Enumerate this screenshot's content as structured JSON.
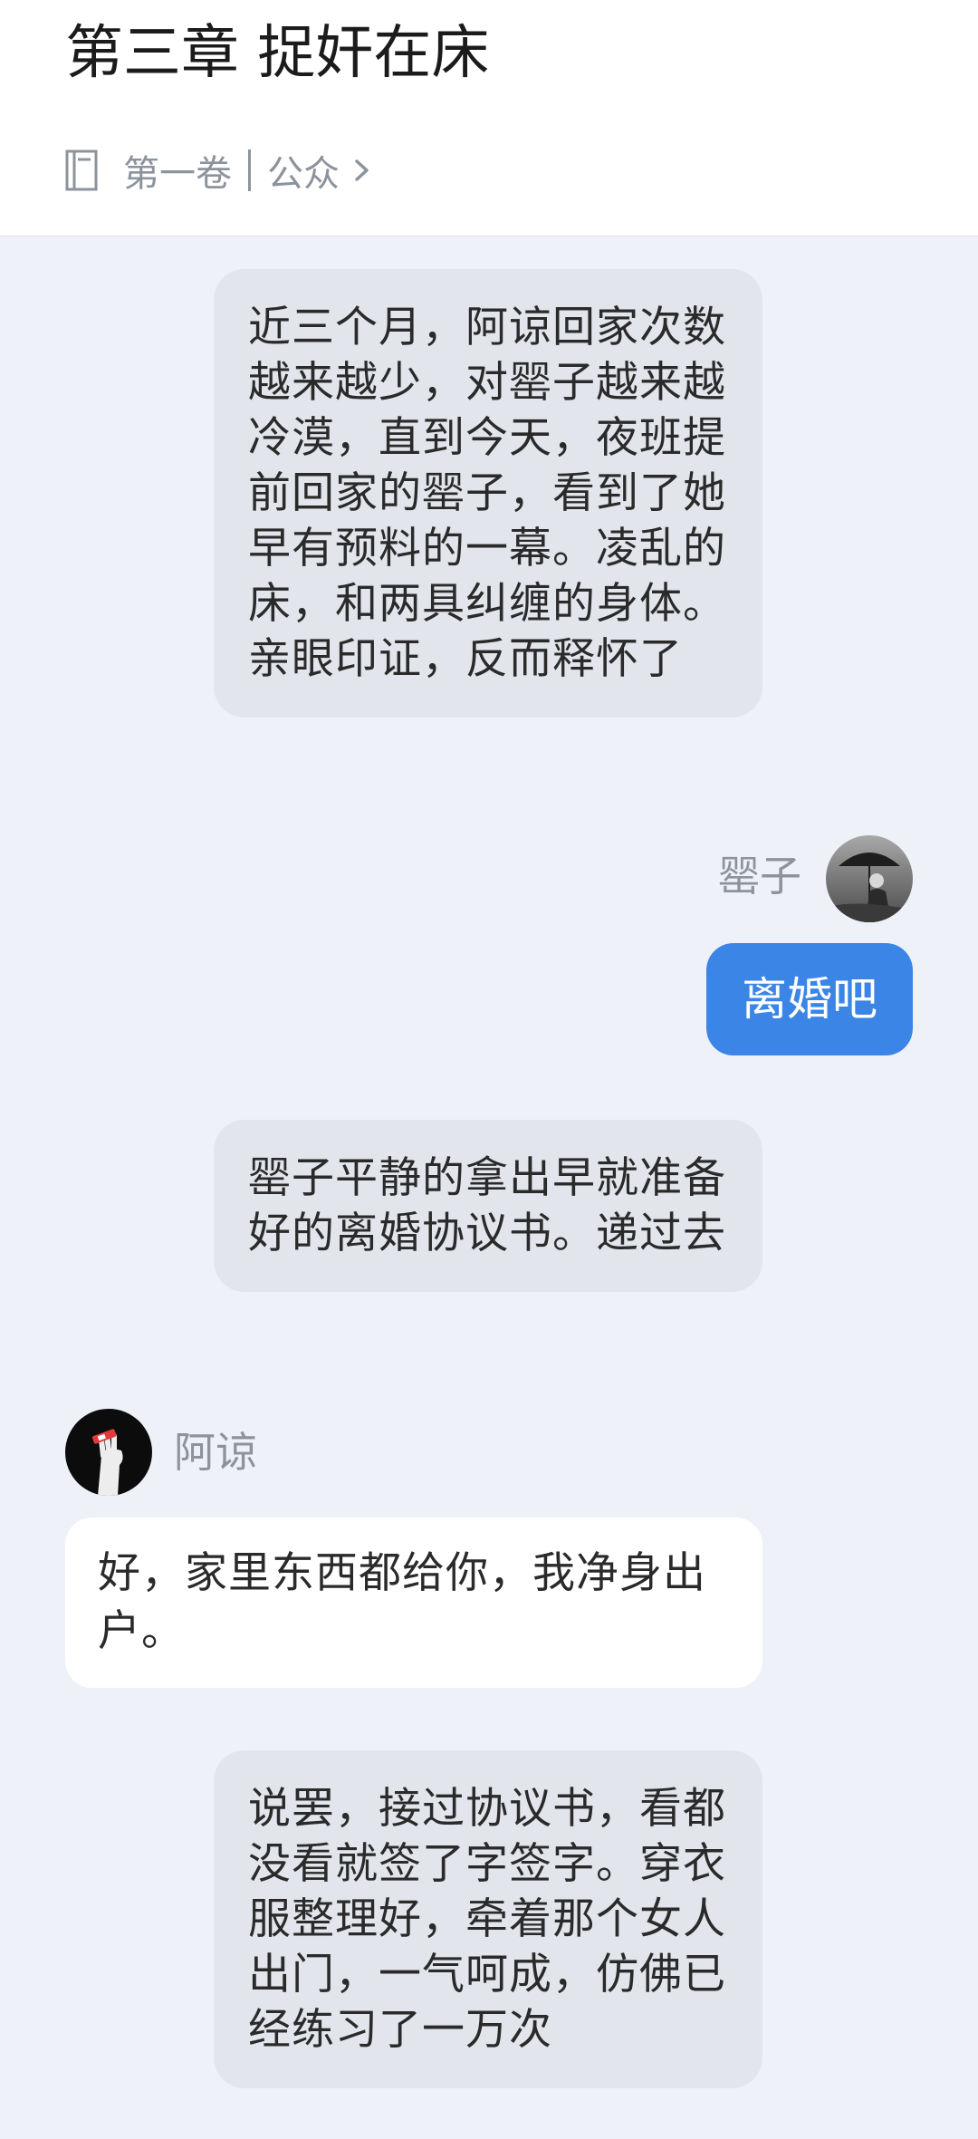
{
  "header": {
    "title": "第三章 捉奸在床",
    "volume": "第一卷",
    "author": "公众"
  },
  "messages": {
    "narration_1": "近三个月，阿谅回家次数越来越少，对罂子越来越冷漠，直到今天，夜班提前回家的罂子，看到了她早有预料的一幕。凌乱的床，和两具纠缠的身体。亲眼印证，反而释怀了",
    "right_name": "罂子",
    "right_text": "离婚吧",
    "narration_2": "罂子平静的拿出早就准备好的离婚协议书。递过去",
    "left_name": "阿谅",
    "left_text": "好，家里东西都给你，我净身出户。",
    "narration_3": "说罢，接过协议书，看都没看就签了字签字。穿衣服整理好，牵着那个女人出门，一气呵成，仿佛已经练习了一万次"
  },
  "icons": {
    "volume": "book-icon",
    "chevron": "chevron-right-icon"
  },
  "colors": {
    "accent": "#3a85e6",
    "narration_bg": "#e2e5ec",
    "page_bg": "#eef2f8",
    "muted_text": "#8c939d"
  }
}
